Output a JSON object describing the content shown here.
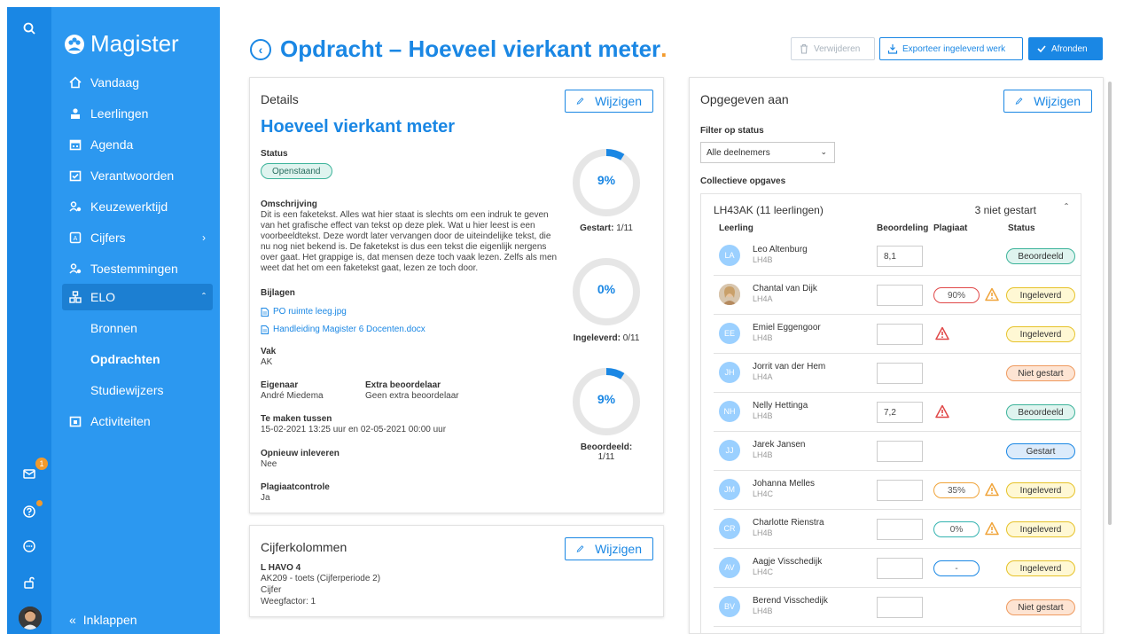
{
  "app": {
    "name": "Magister"
  },
  "sidebar": {
    "items": [
      {
        "label": "Vandaag",
        "icon": "home-icon"
      },
      {
        "label": "Leerlingen",
        "icon": "students-icon"
      },
      {
        "label": "Agenda",
        "icon": "calendar-icon"
      },
      {
        "label": "Verantwoorden",
        "icon": "check-calendar-icon"
      },
      {
        "label": "Keuzewerktijd",
        "icon": "people-icon"
      },
      {
        "label": "Cijfers",
        "icon": "grades-icon"
      },
      {
        "label": "Toestemmingen",
        "icon": "people-icon"
      },
      {
        "label": "ELO",
        "icon": "elo-icon"
      },
      {
        "label": "Activiteiten",
        "icon": "activities-icon"
      }
    ],
    "subitems": [
      "Bronnen",
      "Opdrachten",
      "Studiewijzers"
    ],
    "collapse_label": "Inklappen",
    "mail_badge": "1"
  },
  "header": {
    "title": "Opdracht – Hoeveel vierkant meter",
    "title_dot": ".",
    "delete_label": "Verwijderen",
    "export_label": "Exporteer ingeleverd werk",
    "finish_label": "Afronden"
  },
  "details": {
    "card_title": "Details",
    "edit_label": "Wijzigen",
    "assignment_title": "Hoeveel vierkant meter",
    "status_label": "Status",
    "status_value": "Openstaand",
    "description_label": "Omschrijving",
    "description_lines": [
      "Dit is een faketekst. Alles wat hier staat is slechts om een indruk te geven",
      "van het grafische effect van tekst op deze plek. Wat u hier leest is een",
      "voorbeeldtekst. Deze wordt later vervangen door de uiteindelijke tekst, die",
      "nu nog niet bekend is. De faketekst is dus een tekst die eigenlijk nergens",
      "over gaat. Het grappige is, dat mensen deze toch vaak lezen. Zelfs als men",
      "weet dat het om een faketekst gaat, lezen ze toch door."
    ],
    "attachments_label": "Bijlagen",
    "attachments": [
      "PO ruimte leeg.jpg",
      "Handleiding Magister 6 Docenten.docx"
    ],
    "subject_label": "Vak",
    "subject_value": "AK",
    "owner_label": "Eigenaar",
    "owner_value": "André Miedema",
    "extra_grader_label": "Extra beoordelaar",
    "extra_grader_value": "Geen extra beoordelaar",
    "period_label": "Te maken tussen",
    "period_value": "15-02-2021 13:25 uur en 02-05-2021 00:00 uur",
    "resubmit_label": "Opnieuw inleveren",
    "resubmit_value": "Nee",
    "plagiarism_label": "Plagiaatcontrole",
    "plagiarism_value": "Ja",
    "stats": [
      {
        "pct": "9%",
        "fraction": 0.09,
        "label": "Gestart:",
        "count": "1/11"
      },
      {
        "pct": "0%",
        "fraction": 0.0,
        "label": "Ingeleverd:",
        "count": "0/11"
      },
      {
        "pct": "9%",
        "fraction": 0.09,
        "label": "Beoordeeld:",
        "count": "1/11"
      }
    ]
  },
  "grades_card": {
    "title": "Cijferkolommen",
    "edit_label": "Wijzigen",
    "class": "L HAVO 4",
    "column": "AK209 - toets (Cijferperiode 2)",
    "type": "Cijfer",
    "weight": "Weegfactor: 1"
  },
  "assigned": {
    "card_title": "Opgegeven aan",
    "edit_label": "Wijzigen",
    "filter_label": "Filter op status",
    "filter_value": "Alle deelnemers",
    "collective_label": "Collectieve opgaves",
    "group_name": "LH43AK (11 leerlingen)",
    "group_status": "3 niet gestart",
    "columns": [
      "Leerling",
      "Beoordeling",
      "Plagiaat",
      "Status"
    ],
    "students": [
      {
        "initials": "LA",
        "name": "Leo Altenburg",
        "class": "LH4B",
        "grade": "8,1",
        "plag": "",
        "plag_color": "",
        "warn": "",
        "status": "Beoordeeld",
        "status_color": "green"
      },
      {
        "initials": "",
        "name": "Chantal van Dijk",
        "class": "LH4A",
        "grade": "",
        "plag": "90%",
        "plag_color": "red",
        "warn": "orange",
        "status": "Ingeleverd",
        "status_color": "yellow",
        "photo": true
      },
      {
        "initials": "EE",
        "name": "Emiel Eggengoor",
        "class": "LH4B",
        "grade": "",
        "plag": "",
        "plag_color": "",
        "warn": "red",
        "status": "Ingeleverd",
        "status_color": "yellow"
      },
      {
        "initials": "JH",
        "name": "Jorrit van der Hem",
        "class": "LH4A",
        "grade": "",
        "plag": "",
        "plag_color": "",
        "warn": "",
        "status": "Niet gestart",
        "status_color": "orange"
      },
      {
        "initials": "NH",
        "name": "Nelly Hettinga",
        "class": "LH4B",
        "grade": "7,2",
        "plag": "",
        "plag_color": "",
        "warn": "red",
        "status": "Beoordeeld",
        "status_color": "green"
      },
      {
        "initials": "JJ",
        "name": "Jarek Jansen",
        "class": "LH4B",
        "grade": "",
        "plag": "",
        "plag_color": "",
        "warn": "",
        "status": "Gestart",
        "status_color": "blue"
      },
      {
        "initials": "JM",
        "name": "Johanna Melles",
        "class": "LH4C",
        "grade": "",
        "plag": "35%",
        "plag_color": "orange",
        "warn": "orange",
        "status": "Ingeleverd",
        "status_color": "yellow"
      },
      {
        "initials": "CR",
        "name": "Charlotte Rienstra",
        "class": "LH4B",
        "grade": "",
        "plag": "0%",
        "plag_color": "teal",
        "warn": "orange",
        "status": "Ingeleverd",
        "status_color": "yellow"
      },
      {
        "initials": "AV",
        "name": "Aagje Visschedijk",
        "class": "LH4C",
        "grade": "",
        "plag": "-",
        "plag_color": "blue",
        "warn": "",
        "status": "Ingeleverd",
        "status_color": "yellow"
      },
      {
        "initials": "BV",
        "name": "Berend Visschedijk",
        "class": "LH4B",
        "grade": "",
        "plag": "",
        "plag_color": "",
        "warn": "",
        "status": "Niet gestart",
        "status_color": "orange"
      }
    ]
  },
  "colors": {
    "primary": "#1a87e4",
    "sidebar": "#2c98f0",
    "rail": "#1a87e4",
    "accent": "#f39a2c"
  }
}
